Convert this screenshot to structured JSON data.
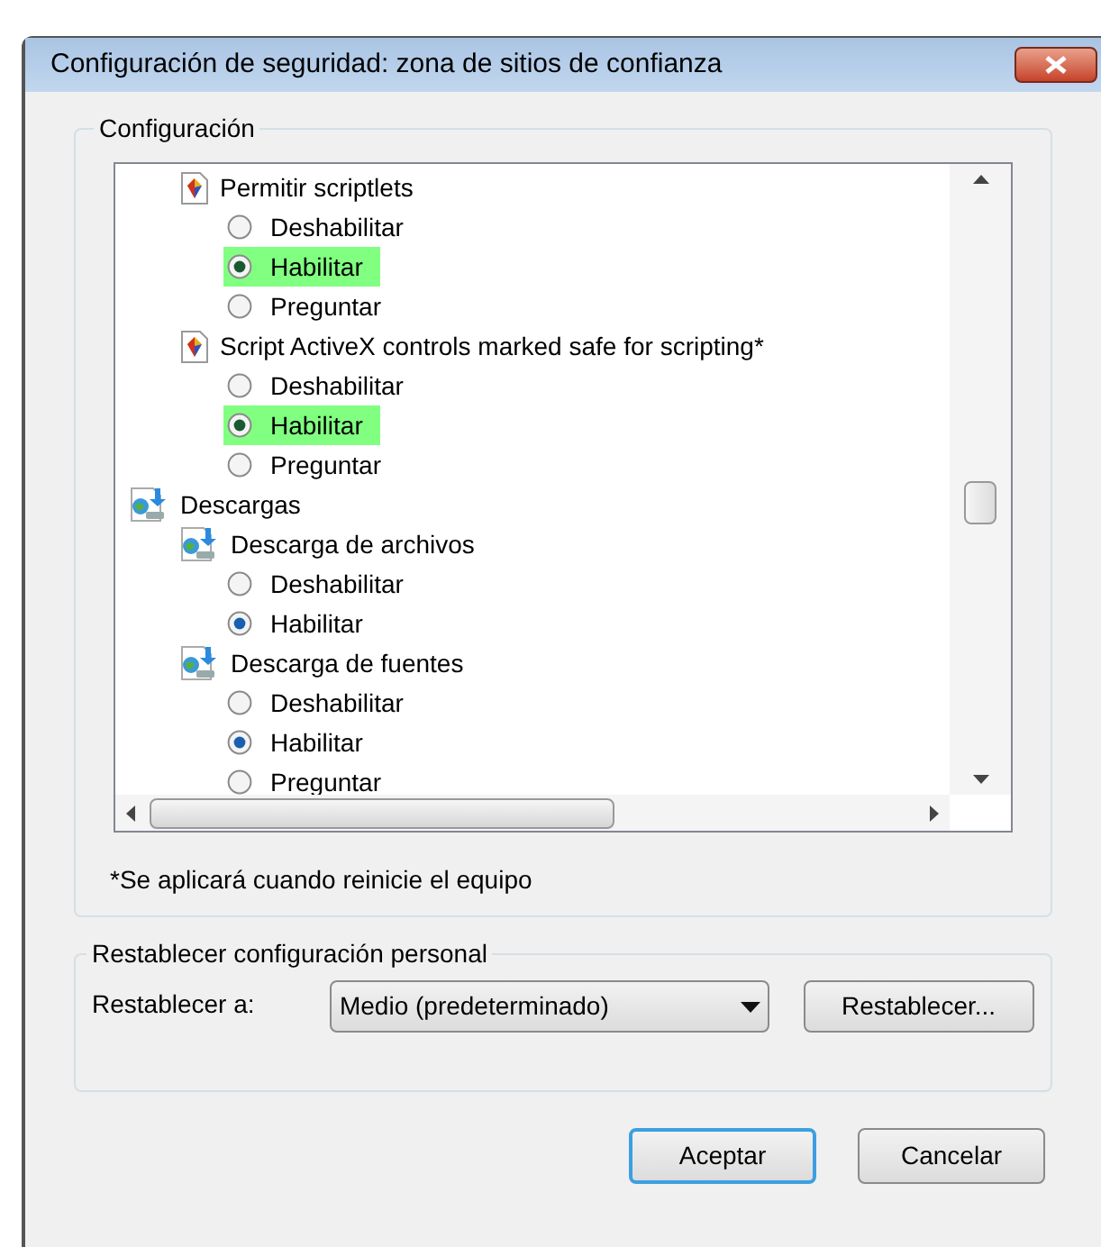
{
  "window": {
    "title": "Configuración de seguridad: zona de sitios de confianza"
  },
  "settings_group": {
    "title": "Configuración",
    "items": [
      {
        "kind": "setting",
        "label": "Permitir scriptlets",
        "options": [
          {
            "label": "Deshabilitar",
            "selected": false,
            "highlighted": false
          },
          {
            "label": "Habilitar",
            "selected": true,
            "highlighted": true
          },
          {
            "label": "Preguntar",
            "selected": false,
            "highlighted": false
          }
        ]
      },
      {
        "kind": "setting",
        "label": "Script ActiveX controls marked safe for scripting*",
        "options": [
          {
            "label": "Deshabilitar",
            "selected": false,
            "highlighted": false
          },
          {
            "label": "Habilitar",
            "selected": true,
            "highlighted": true
          },
          {
            "label": "Preguntar",
            "selected": false,
            "highlighted": false
          }
        ]
      },
      {
        "kind": "category",
        "label": "Descargas",
        "children": [
          {
            "kind": "setting",
            "label": "Descarga de archivos",
            "options": [
              {
                "label": "Deshabilitar",
                "selected": false,
                "highlighted": false
              },
              {
                "label": "Habilitar",
                "selected": true,
                "highlighted": false
              }
            ]
          },
          {
            "kind": "setting",
            "label": "Descarga de fuentes",
            "options": [
              {
                "label": "Deshabilitar",
                "selected": false,
                "highlighted": false
              },
              {
                "label": "Habilitar",
                "selected": true,
                "highlighted": false
              },
              {
                "label": "Preguntar",
                "selected": false,
                "highlighted": false
              }
            ]
          }
        ]
      }
    ],
    "footnote": "*Se aplicará cuando reinicie el equipo"
  },
  "reset_group": {
    "title": "Restablecer configuración personal",
    "label": "Restablecer a:",
    "dropdown_value": "Medio (predeterminado)",
    "button": "Restablecer..."
  },
  "buttons": [
    "Aceptar",
    "Cancelar"
  ]
}
